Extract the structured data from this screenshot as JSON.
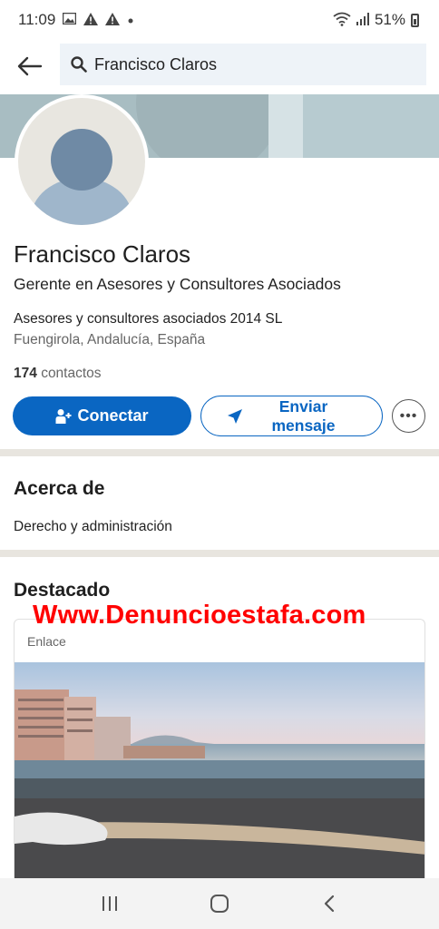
{
  "status": {
    "time": "11:09",
    "battery": "51%",
    "notification_icons": [
      "image-icon",
      "warning-icon",
      "warning-icon",
      "dot-icon"
    ]
  },
  "search": {
    "value": "Francisco Claros"
  },
  "profile": {
    "name": "Francisco Claros",
    "headline": "Gerente en Asesores y Consultores Asociados",
    "company": "Asesores y consultores asociados 2014 SL",
    "location": "Fuengirola, Andalucía, España",
    "contacts_count": "174",
    "contacts_label": "contactos"
  },
  "actions": {
    "connect_label": "Conectar",
    "message_line1": "Enviar",
    "message_line2": "mensaje",
    "more_label": "•••"
  },
  "about": {
    "title": "Acerca de",
    "text": "Derecho y administración"
  },
  "featured": {
    "title": "Destacado",
    "card_tag": "Enlace"
  },
  "watermark": "Www.Denuncioestafa.com",
  "colors": {
    "primary": "#0a66c2",
    "watermark": "#ff0000",
    "divider": "#e8e5df"
  }
}
